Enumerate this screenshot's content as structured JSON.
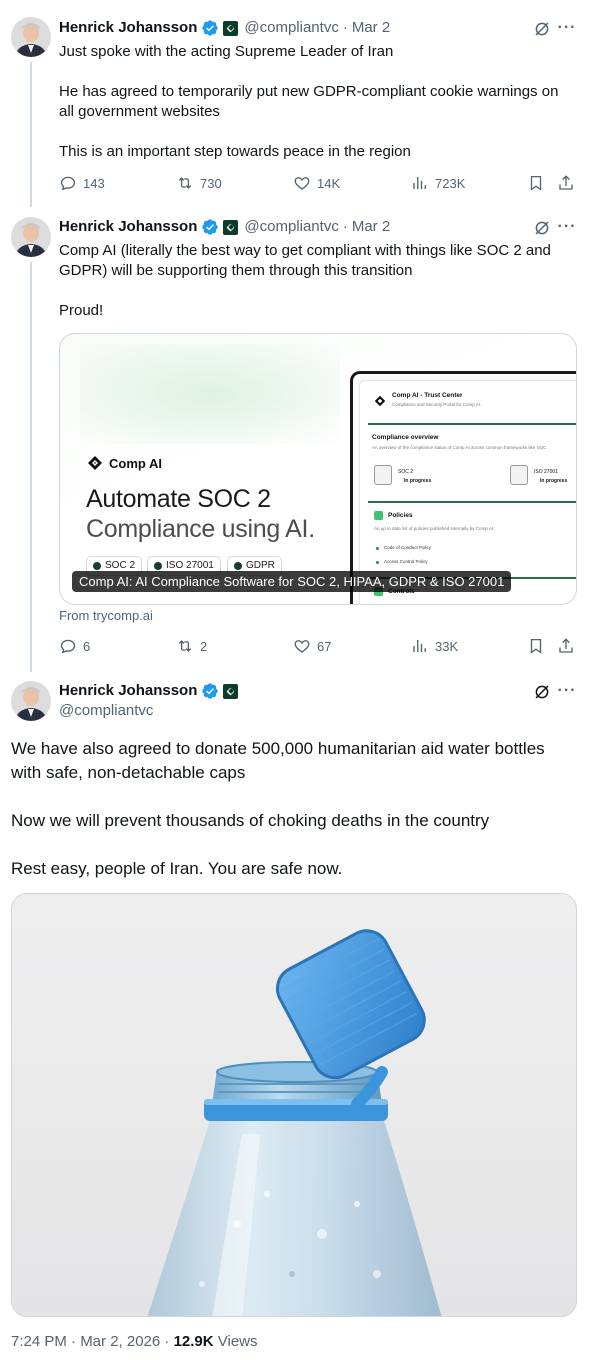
{
  "tweets": [
    {
      "name": "Henrick Johansson",
      "handle": "@compliantvc",
      "date": "Mar 2",
      "lines": [
        "Just spoke with the acting Supreme Leader of Iran",
        "He has agreed to temporarily put new GDPR-compliant cookie warnings on",
        "all government websites",
        "This is an important step towards peace in the region"
      ],
      "replies": "143",
      "reposts": "730",
      "likes": "14K",
      "views": "723K"
    },
    {
      "name": "Henrick Johansson",
      "handle": "@compliantvc",
      "date": "Mar 2",
      "lines": [
        "Comp AI (literally the best way to get compliant with things like SOC 2 and",
        "GDPR) will be supporting them through this transition",
        "Proud!"
      ],
      "replies": "6",
      "reposts": "2",
      "likes": "67",
      "views": "33K",
      "card": {
        "brand": "Comp AI",
        "headline_line1": "Automate SOC 2",
        "headline_line2": "Compliance using AI.",
        "pills": [
          "SOC 2",
          "ISO 27001",
          "GDPR"
        ],
        "caption": "Comp AI: AI Compliance Software for SOC 2, HIPAA, GDPR & ISO 27001",
        "source": "From trycomp.ai",
        "panel": {
          "title": "Comp AI - Trust Center",
          "subtitle": "Compliance and Security Portal for Comp AI.",
          "overview_title": "Compliance overview",
          "overview_sub": "An overview of the compliance status of Comp AI across common frameworks like SOC",
          "badge1_name": "SOC 2",
          "badge1_status": "In progress",
          "badge2_name": "ISO 27001",
          "badge2_status": "In progress",
          "policies_title": "Policies",
          "policies_sub": "An up to date list of policies published internally by Comp AI.",
          "policy1": "Code of Conduct Policy",
          "policy2": "Access Control Policy",
          "controls_title": "Controls"
        }
      }
    }
  ],
  "main_tweet": {
    "name": "Henrick Johansson",
    "handle": "@compliantvc",
    "para1_line1": "We have also agreed to donate 500,000 humanitarian aid water bottles",
    "para1_line2": "with safe, non-detachable caps",
    "para2": "Now we will prevent thousands of choking deaths in the country",
    "para3": "Rest easy, people of Iran. You are safe now.",
    "timestamp": "7:24 PM · Mar 2, 2026 · ",
    "views_count": "12.9K",
    "views_label": " Views"
  },
  "colors": {
    "text": "#0f1419",
    "secondary": "#536471",
    "verified": "#1d9bf0",
    "border": "#cfd9de",
    "affiliate": "#0b3d2c",
    "cap_blue": "#3a93db"
  },
  "icons": [
    "reply-icon",
    "repost-icon",
    "like-icon",
    "views-icon",
    "bookmark-icon",
    "share-icon",
    "grok-icon",
    "more-icon",
    "verified-badge-icon"
  ]
}
